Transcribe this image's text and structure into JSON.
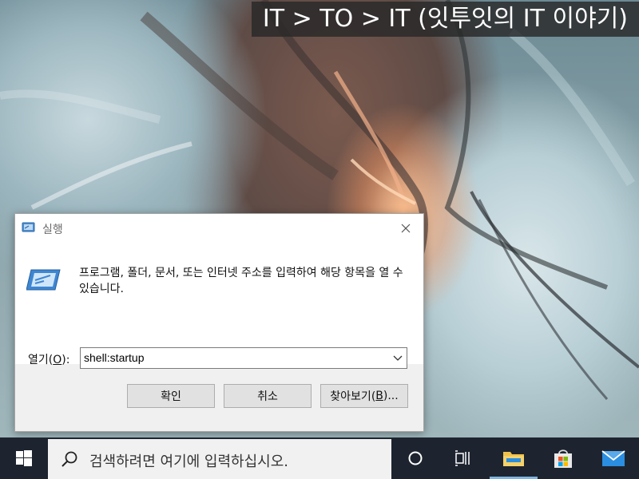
{
  "banner": {
    "text": "IT > TO > IT (잇투잇의 IT 이야기)"
  },
  "dialog": {
    "title": "실행",
    "description": "프로그램, 폴더, 문서, 또는 인터넷 주소를 입력하여 해당 항목을 열 수 있습니다.",
    "open_label_prefix": "열기(",
    "open_label_key": "O",
    "open_label_suffix": "):",
    "open_value": "shell:startup",
    "ok_label": "확인",
    "cancel_label": "취소",
    "browse_label_prefix": "찾아보기(",
    "browse_label_key": "B",
    "browse_label_suffix": ")..."
  },
  "taskbar": {
    "search_placeholder": "검색하려면 여기에 입력하십시오.",
    "icons": [
      "windows-start-icon",
      "cortana-icon",
      "task-view-icon",
      "file-explorer-icon",
      "microsoft-store-icon",
      "mail-icon"
    ]
  },
  "colors": {
    "taskbar_bg": "#1d2430",
    "dialog_bg": "#f0f0f0",
    "accent": "#0078d7"
  }
}
